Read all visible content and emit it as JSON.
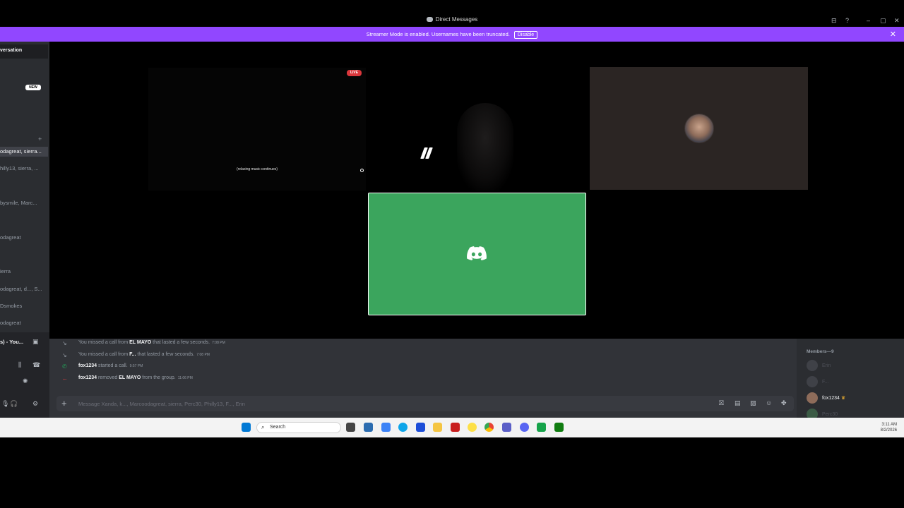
{
  "window": {
    "title": "Direct Messages",
    "controls": {
      "inbox": "⊟",
      "help": "?",
      "minimize": "–",
      "maximize": "▢",
      "close": "✕"
    }
  },
  "streamer_banner": {
    "message": "Streamer Mode is enabled. Usernames have been truncated.",
    "button": "Disable",
    "close": "✕",
    "color": "#9147ff"
  },
  "sidebar": {
    "header": "versation",
    "new_badge": "NEW",
    "add": "+",
    "dms": [
      "odagreat, sierra...",
      "hilly13, sierra, ...",
      "bysmile, Marc...",
      "odagreat",
      "ierra",
      "odagreat, d..., S...",
      "Dsmokes",
      "odagreat"
    ],
    "user_panel": {
      "voice_status": "s) - You...",
      "mic": "🎙",
      "headset": "🎧",
      "settings": "⚙"
    }
  },
  "call": {
    "live_badge": "LIVE",
    "stream_caption": "(relaxing music continues)",
    "tile_colors": {
      "green": "#3ba55d",
      "avatar_bg": "#2b2523"
    }
  },
  "chat": {
    "lines": [
      {
        "icon": "↘",
        "pre": "You missed a call from ",
        "name": "EL MAYO",
        "post": " that lasted a few seconds.",
        "time": "7:08 PM",
        "color": "#949ba4"
      },
      {
        "icon": "↘",
        "pre": "You missed a call from ",
        "name": "F...",
        "post": " that lasted a few seconds.",
        "time": "7:08 PM",
        "color": "#949ba4"
      },
      {
        "icon": "✆",
        "pre": "",
        "name": "fox1234",
        "post": " started a call.",
        "time": "9:57 PM",
        "color": "#23a55a"
      },
      {
        "icon": "←",
        "pre": "",
        "name": "fox1234",
        "post": " removed ",
        "name2": "EL MAYO",
        "post2": " from the group.",
        "time": "11:06 PM",
        "color": "#f23f43"
      }
    ],
    "input_placeholder": "Message Xanda, k..., Marcoodagreat, sierra, Perc30, Philly13, F..., Erin"
  },
  "members": {
    "header": "Members—9",
    "list": [
      {
        "name": "Erin",
        "owner": false
      },
      {
        "name": "F...",
        "owner": false
      },
      {
        "name": "fox1234",
        "owner": true
      },
      {
        "name": "Perc30",
        "owner": false
      }
    ]
  },
  "taskbar": {
    "search": "Search",
    "time": "3:11 AM",
    "date": "8/2/2026"
  }
}
